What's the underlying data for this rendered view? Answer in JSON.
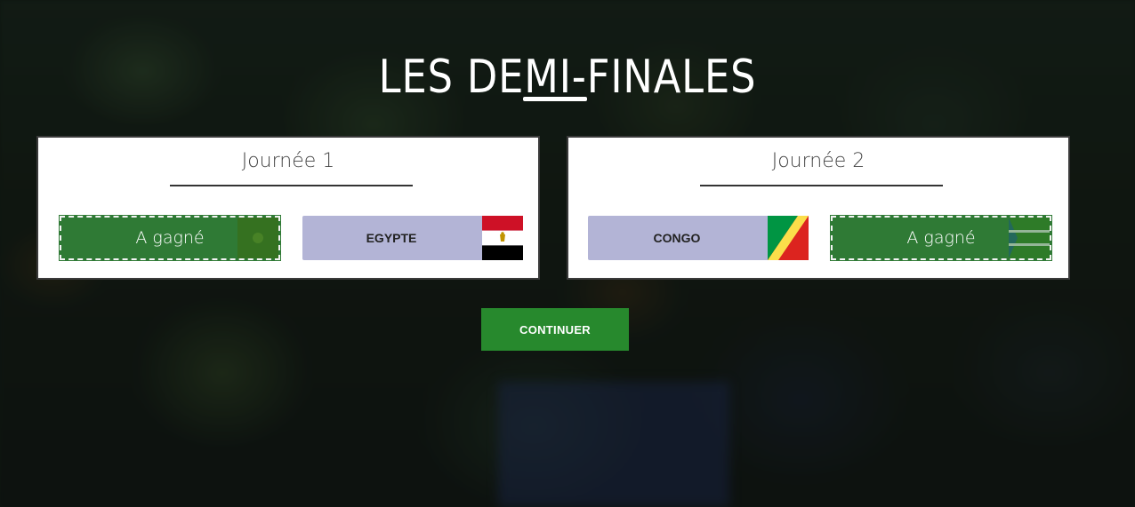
{
  "page": {
    "title": "LES DEMI-FINALES"
  },
  "matches": [
    {
      "label": "Journée 1",
      "teams": [
        {
          "name": "",
          "status": "A gagné",
          "flag": "generic-green-flag-icon"
        },
        {
          "name": "EGYPTE",
          "flag": "egypt-flag-icon"
        }
      ]
    },
    {
      "label": "Journée 2",
      "teams": [
        {
          "name": "CONGO",
          "flag": "congo-flag-icon"
        },
        {
          "name": "",
          "status": "A gagné",
          "flag": "generic-green-flag-icon"
        }
      ]
    }
  ],
  "actions": {
    "continue_label": "CONTINUER"
  },
  "colors": {
    "winner": "#2f7a35",
    "team_bg": "#b3b4d6",
    "continue": "#27892d"
  }
}
